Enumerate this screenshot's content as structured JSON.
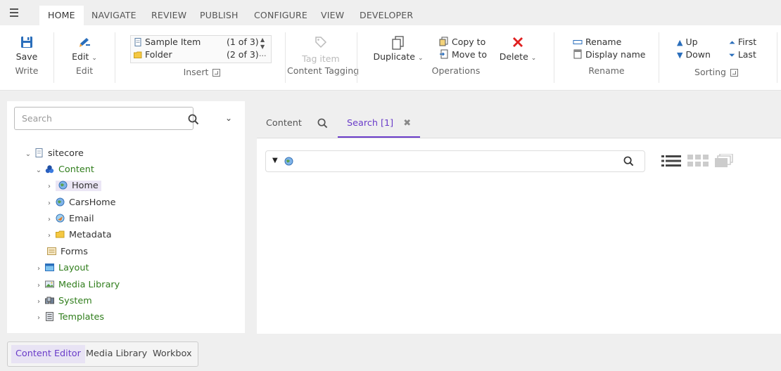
{
  "menu_tabs": [
    "HOME",
    "NAVIGATE",
    "REVIEW",
    "PUBLISH",
    "CONFIGURE",
    "VIEW",
    "DEVELOPER"
  ],
  "active_menu_tab": "HOME",
  "ribbon": {
    "write": {
      "save_label": "Save",
      "group_label": "Write"
    },
    "edit": {
      "edit_label": "Edit",
      "group_label": "Edit"
    },
    "insert": {
      "items": [
        {
          "label": "Sample Item",
          "count": "(1 of 3)"
        },
        {
          "label": "Folder",
          "count": "(2 of 3)"
        }
      ],
      "more": "...",
      "group_label": "Insert"
    },
    "tagging": {
      "tag_label": "Tag item",
      "group_label": "Content Tagging"
    },
    "operations": {
      "duplicate_label": "Duplicate",
      "copy_label": "Copy to",
      "move_label": "Move to",
      "delete_label": "Delete",
      "group_label": "Operations"
    },
    "rename": {
      "rename_label": "Rename",
      "display_label": "Display name",
      "group_label": "Rename"
    },
    "sorting": {
      "up_label": "Up",
      "down_label": "Down",
      "first_label": "First",
      "last_label": "Last",
      "group_label": "Sorting"
    }
  },
  "tree": {
    "search_placeholder": "Search",
    "nodes": [
      {
        "label": "sitecore",
        "icon": "page-icon",
        "green": false
      },
      {
        "label": "Content",
        "icon": "content-icon",
        "green": true
      },
      {
        "label": "Home",
        "icon": "globe-icon",
        "green": false,
        "selected": true
      },
      {
        "label": "CarsHome",
        "icon": "globe-icon",
        "green": false
      },
      {
        "label": "Email",
        "icon": "email-icon",
        "green": false
      },
      {
        "label": "Metadata",
        "icon": "folder-icon",
        "green": false
      },
      {
        "label": "Forms",
        "icon": "forms-icon",
        "green": false
      },
      {
        "label": "Layout",
        "icon": "layout-icon",
        "green": true
      },
      {
        "label": "Media Library",
        "icon": "media-icon",
        "green": true
      },
      {
        "label": "System",
        "icon": "system-icon",
        "green": true
      },
      {
        "label": "Templates",
        "icon": "templates-icon",
        "green": true
      }
    ]
  },
  "content_tabs": {
    "content_label": "Content",
    "search_label": "Search [1]"
  },
  "bottom_tabs": [
    "Content Editor",
    "Media Library",
    "Workbox"
  ],
  "colors": {
    "accent": "#6a3cc9",
    "tree_green": "#2f7d1b",
    "delete_red": "#e02020",
    "ribbon_blue": "#2a6ebb"
  }
}
